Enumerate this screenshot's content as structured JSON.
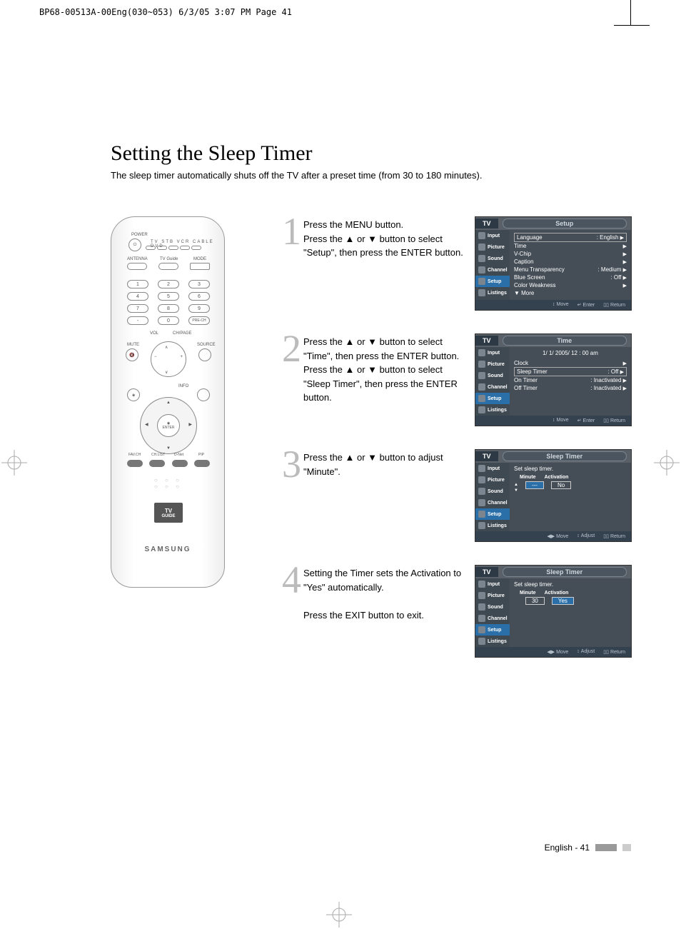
{
  "header_strip": "BP68-00513A-00Eng(030~053)  6/3/05  3:07 PM  Page 41",
  "title": "Setting the Sleep Timer",
  "subtitle": "The sleep timer automatically shuts off the TV after a preset time (from 30 to 180 minutes).",
  "remote": {
    "power": "POWER",
    "sources": "TV  STB  VCR  CABLE  DVD",
    "antenna": "ANTENNA",
    "tvguide": "TV Guide",
    "mode": "MODE",
    "nums": [
      "1",
      "2",
      "3",
      "4",
      "5",
      "6",
      "7",
      "8",
      "9",
      "-",
      "0",
      "PRE-CH"
    ],
    "vol": "VOL",
    "chpage": "CH/PAGE",
    "mute": "MUTE",
    "source": "SOURCE",
    "info": "INFO",
    "enter": "ENTER",
    "bottom_labels": [
      "FAV.CH",
      "CH.LIST",
      "D-Net",
      "PIP"
    ],
    "tvguide_logo_top": "TV",
    "tvguide_logo_bot": "GUIDE",
    "brand": "SAMSUNG"
  },
  "steps": [
    {
      "n": "1",
      "text": "Press the MENU button.\nPress the ▲ or ▼ button to select \"Setup\", then press the ENTER button."
    },
    {
      "n": "2",
      "text": "Press the ▲ or ▼ button to select \"Time\", then press the ENTER button.\nPress the ▲ or ▼ button to select \"Sleep Timer\", then press the ENTER button."
    },
    {
      "n": "3",
      "text": "Press the ▲ or ▼ button to adjust \"Minute\"."
    },
    {
      "n": "4",
      "text": "Setting the Timer sets the Activation to \"Yes\" automatically.\n\nPress the EXIT button to exit."
    }
  ],
  "osd_side": [
    "Input",
    "Picture",
    "Sound",
    "Channel",
    "Setup",
    "Listings"
  ],
  "osd1": {
    "tv": "TV",
    "title": "Setup",
    "rows": [
      {
        "l": "Language",
        "r": ": English",
        "boxed": true
      },
      {
        "l": "Time",
        "r": ""
      },
      {
        "l": "V-Chip",
        "r": ""
      },
      {
        "l": "Caption",
        "r": ""
      },
      {
        "l": "Menu Transparency",
        "r": ": Medium"
      },
      {
        "l": "Blue Screen",
        "r": ": Off"
      },
      {
        "l": "Color Weakness",
        "r": ""
      },
      {
        "l": "▼ More",
        "r": "",
        "noarrow": true
      }
    ],
    "foot": [
      "Move",
      "Enter",
      "Return"
    ],
    "foot_icons": [
      "↕",
      "↵",
      "▯▯"
    ]
  },
  "osd2": {
    "tv": "TV",
    "title": "Time",
    "datetime": "1/  1/ 2005/ 12 : 00 am",
    "rows": [
      {
        "l": "Clock",
        "r": ""
      },
      {
        "l": "Sleep Timer",
        "r": ": Off",
        "boxed": true
      },
      {
        "l": "On Timer",
        "r": ": Inactivated"
      },
      {
        "l": "Off Timer",
        "r": ": Inactivated"
      }
    ],
    "foot": [
      "Move",
      "Enter",
      "Return"
    ],
    "foot_icons": [
      "↕",
      "↵",
      "▯▯"
    ]
  },
  "osd3": {
    "tv": "TV",
    "title": "Sleep Timer",
    "head": "Set sleep timer.",
    "cols": [
      "Minute",
      "Activation"
    ],
    "minute": "---",
    "activation": "No",
    "foot": [
      "Move",
      "Adjust",
      "Return"
    ],
    "foot_icons": [
      "◀▶",
      "↕",
      "▯▯"
    ]
  },
  "osd4": {
    "tv": "TV",
    "title": "Sleep Timer",
    "head": "Set sleep timer.",
    "cols": [
      "Minute",
      "Activation"
    ],
    "minute": "30",
    "activation": "Yes",
    "foot": [
      "Move",
      "Adjust",
      "Return"
    ],
    "foot_icons": [
      "◀▶",
      "↕",
      "▯▯"
    ]
  },
  "footer": "English - 41"
}
